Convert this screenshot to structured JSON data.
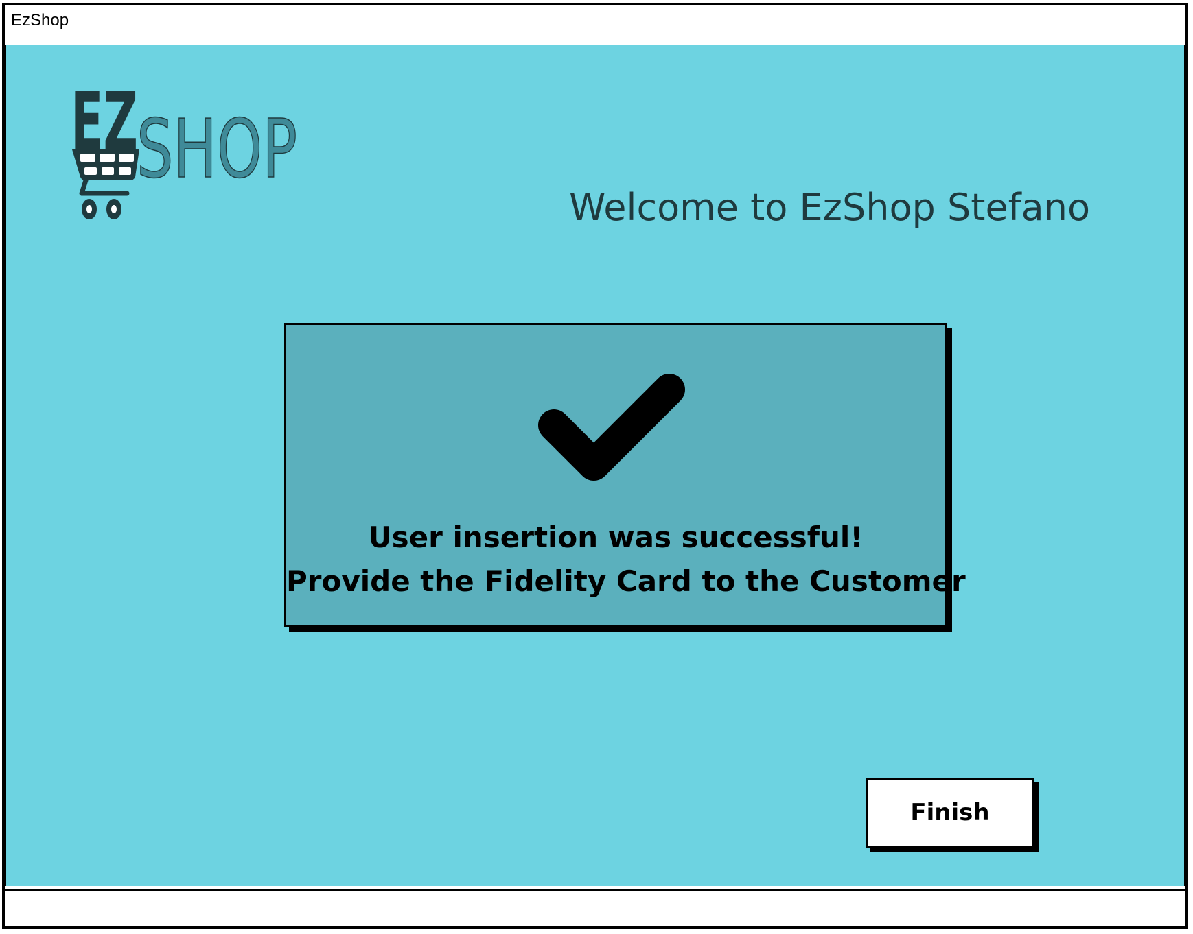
{
  "window": {
    "title": "EzShop"
  },
  "logo": {
    "text_primary": "EZ",
    "text_secondary": "SHOP",
    "icon": "shopping-cart-icon",
    "colors": {
      "dark": "#1f3a3e",
      "teal": "#3f8a98"
    }
  },
  "header": {
    "welcome_text": "Welcome to EzShop Stefano"
  },
  "dialog": {
    "icon": "checkmark-icon",
    "message_line1": "User insertion was successful!",
    "message_line2": "Provide the Fidelity Card to the Customer"
  },
  "actions": {
    "finish_label": "Finish"
  },
  "colors": {
    "background": "#6dd3e1",
    "dialog_background": "#5bb0bd",
    "text_dark": "#1f3a3e"
  }
}
